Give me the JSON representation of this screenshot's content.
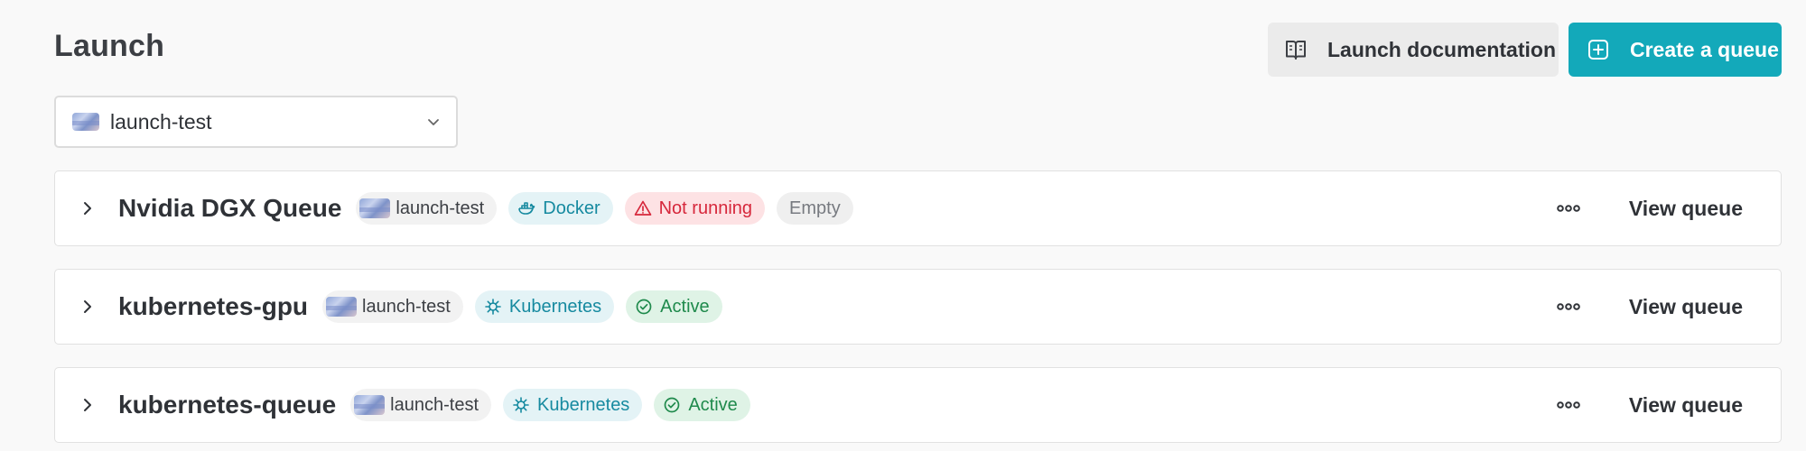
{
  "header": {
    "title": "Launch",
    "docs_button": {
      "label": "Launch documentation",
      "icon": "book-icon"
    },
    "create_button": {
      "label": "Create a queue",
      "icon": "plus-square-icon"
    }
  },
  "entity_select": {
    "value": "launch-test",
    "icon": "chevron-down-icon"
  },
  "colors": {
    "accent": "#13a9ba",
    "error_text": "#d6273b",
    "error_bg": "#fde2e4",
    "active_text": "#1f8a4c",
    "active_bg": "#dff3e6",
    "info_text": "#168aa0",
    "info_bg": "#e4f3f6"
  },
  "queues": [
    {
      "name": "Nvidia DGX Queue",
      "entity": "launch-test",
      "resource": "Docker",
      "status": "Not running",
      "extra": "Empty",
      "action": "View queue"
    },
    {
      "name": "kubernetes-gpu",
      "entity": "launch-test",
      "resource": "Kubernetes",
      "status": "Active",
      "action": "View queue"
    },
    {
      "name": "kubernetes-queue",
      "entity": "launch-test",
      "resource": "Kubernetes",
      "status": "Active",
      "action": "View queue"
    }
  ]
}
